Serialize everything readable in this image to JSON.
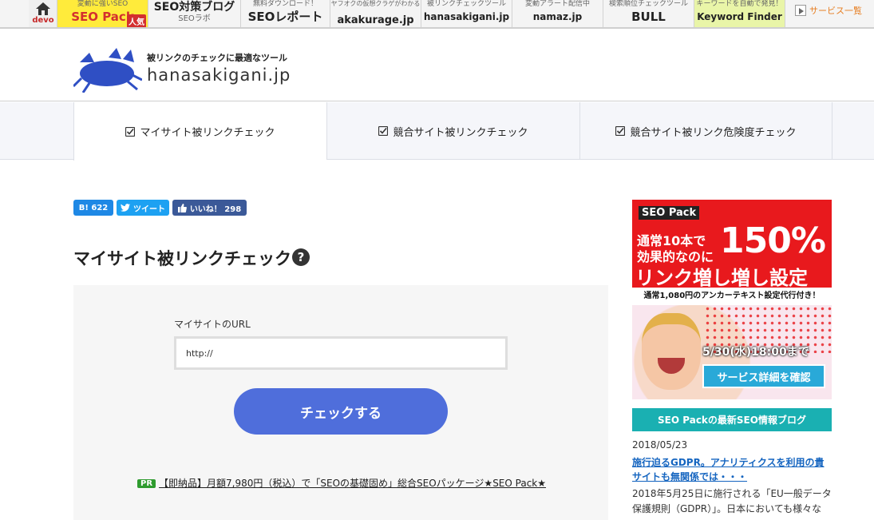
{
  "topbar": {
    "home": {
      "label": "devo"
    },
    "items": [
      {
        "sub": "変動に強いSEO",
        "main": "SEO Pack",
        "badge": "人気"
      },
      {
        "sub": "SEO対策ブログ",
        "main": "SEOラボ"
      },
      {
        "sub": "無料ダウンロード！",
        "main": "SEOレポート"
      },
      {
        "sub": "ヤフオクの仮想クラゲがわかる",
        "main": "akakurage.jp"
      },
      {
        "sub": "被リンクチェックツール",
        "main": "hanasakigani.jp"
      },
      {
        "sub": "変動アラート配信中",
        "main": "namaz.jp"
      },
      {
        "sub": "検索順位チェックツール",
        "main": "BULL"
      },
      {
        "sub": "キーワードを自動で発見！",
        "main": "Keyword Finder"
      }
    ],
    "more": "サービス一覧"
  },
  "header": {
    "tagline": "被リンクのチェックに最適なツール",
    "domain": "hanasakigani.jp"
  },
  "nav": {
    "tabs": [
      {
        "label": "マイサイト被リンクチェック",
        "active": true
      },
      {
        "label": "競合サイト被リンクチェック",
        "active": false
      },
      {
        "label": "競合サイト被リンク危険度チェック",
        "active": false
      }
    ]
  },
  "social": {
    "hatena": "B! 622",
    "tweet": "ツイート",
    "like": "いいね！ 298"
  },
  "main": {
    "title": "マイサイト被リンクチェック",
    "help": "?",
    "url_label": "マイサイトのURL",
    "url_value": "http://",
    "check_button": "チェックする",
    "pr_badge": "PR",
    "pr_text": "【即納品】月額7,980円（税込）で「SEOの基礎固め」総合SEOパッケージ★SEO Pack★"
  },
  "ad": {
    "brand": "SEO Pack",
    "line1": "通常10本で",
    "line2": "効果的なのに",
    "big": "150%",
    "line3": "リンク増し増し設定",
    "strip": "通常1,080円のアンカーテキスト設定代行付き！",
    "date": "5/30(水)18:00まで",
    "cta": "サービス詳細を確認"
  },
  "sidebar": {
    "blog_heading": "SEO Packの最新SEO情報ブログ",
    "post_date": "2018/05/23",
    "post_title": "施行迫るGDPR。アナリティクスを利用の貴サイトも無関係では・・・",
    "post_excerpt": "2018年5月25日に施行される「EU一般データ保護規則（GDPR）」。日本においても様々な"
  },
  "colors": {
    "accent_button": "#4f6edb",
    "ad_red": "#e8191d",
    "blog_teal": "#1ab0b2",
    "link_blue": "#1565c0"
  }
}
